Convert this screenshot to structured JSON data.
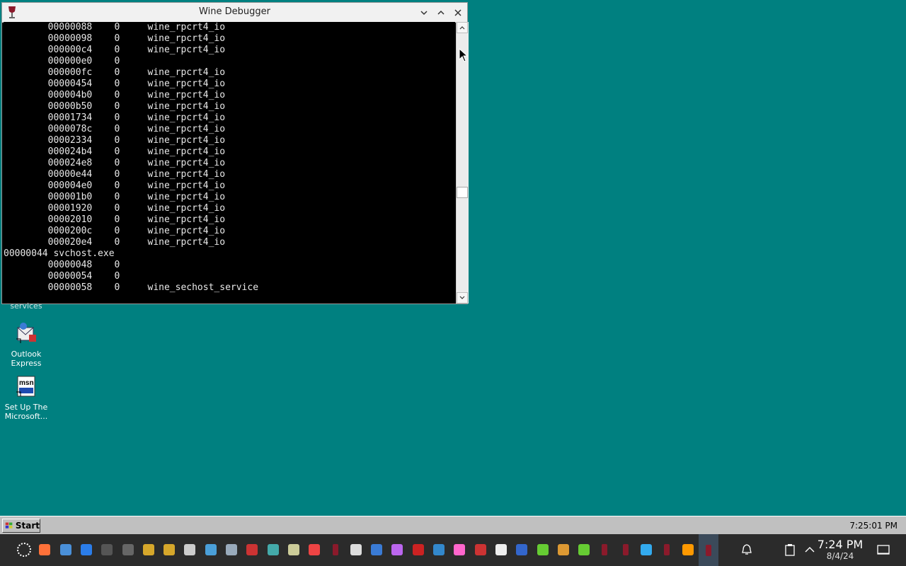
{
  "window": {
    "title": "Wine Debugger",
    "lines": [
      "        00000088    0     wine_rpcrt4_io",
      "        00000098    0     wine_rpcrt4_io",
      "        000000c4    0     wine_rpcrt4_io",
      "        000000e0    0",
      "        000000fc    0     wine_rpcrt4_io",
      "        00000454    0     wine_rpcrt4_io",
      "        000004b0    0     wine_rpcrt4_io",
      "        00000b50    0     wine_rpcrt4_io",
      "        00001734    0     wine_rpcrt4_io",
      "        0000078c    0     wine_rpcrt4_io",
      "        00002334    0     wine_rpcrt4_io",
      "        000024b4    0     wine_rpcrt4_io",
      "        000024e8    0     wine_rpcrt4_io",
      "        00000e44    0     wine_rpcrt4_io",
      "        000004e0    0     wine_rpcrt4_io",
      "        000001b0    0     wine_rpcrt4_io",
      "        00001920    0     wine_rpcrt4_io",
      "        00002010    0     wine_rpcrt4_io",
      "        0000200c    0     wine_rpcrt4_io",
      "        000020e4    0     wine_rpcrt4_io",
      "00000044 svchost.exe",
      "        00000048    0",
      "        00000054    0",
      "        00000058    0     wine_sechost_service"
    ],
    "scroll_position": 0.62
  },
  "desktop": {
    "partial_label": "services",
    "icons": [
      {
        "label": "Outlook Express",
        "icon": "outlook-express-icon"
      },
      {
        "label": "Set Up The Microsoft...",
        "icon": "msn-setup-icon"
      }
    ]
  },
  "wine_taskbar": {
    "start_label": "Start",
    "clock": "7:25:01 PM"
  },
  "host_taskbar": {
    "time": "7:24 PM",
    "date": "8/4/24",
    "apps": [
      "launcher-icon",
      "firefox-icon",
      "file-manager-icon",
      "mail-icon",
      "terminal-icon",
      "console-icon",
      "app-icon",
      "app-icon",
      "archive-icon",
      "app-icon",
      "app-icon",
      "app-icon",
      "app-icon",
      "app-icon",
      "chrome-icon",
      "wine-icon",
      "cloud-icon",
      "app-icon",
      "app-icon",
      "app-icon",
      "app-icon",
      "app-icon",
      "app-icon",
      "app-icon",
      "app-icon",
      "app-icon",
      "app-icon",
      "app-icon",
      "wine-icon",
      "wine-icon",
      "app-icon",
      "wine-icon",
      "app-icon",
      "wine-debugger-icon"
    ]
  },
  "colors": {
    "desktop": "#008080",
    "console_bg": "#000000",
    "console_text": "#e8e8e8",
    "host_taskbar": "#2b2b2b"
  }
}
